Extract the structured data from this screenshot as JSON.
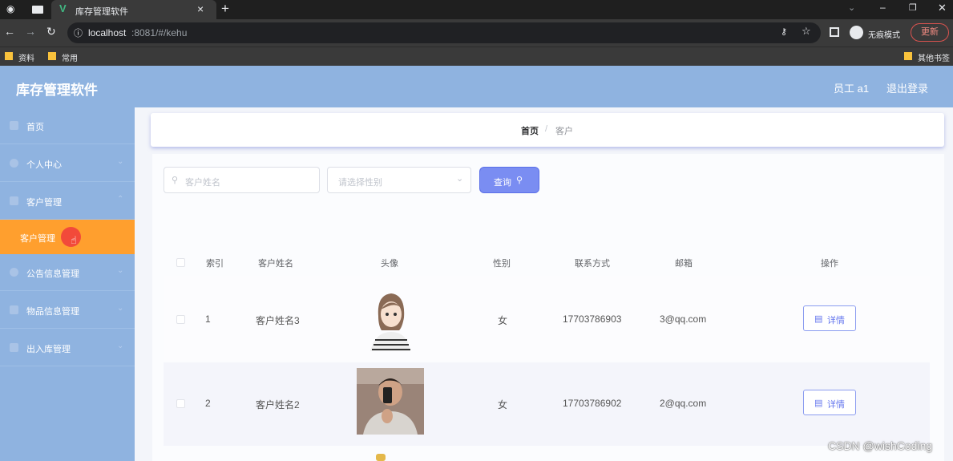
{
  "browser": {
    "tab_title": "库存管理软件",
    "tab_close": "×",
    "new_tab": "+",
    "url_host": "localhost",
    "url_rest": ":8081/#/kehu",
    "incognito": "无痕模式",
    "update": "更新",
    "bookmarks": [
      "资料",
      "常用"
    ],
    "other_bookmarks": "其他书签"
  },
  "app": {
    "title": "库存管理软件",
    "user": "员工 a1",
    "logout": "退出登录"
  },
  "sidebar": {
    "items": [
      "首页",
      "个人中心",
      "客户管理",
      "公告信息管理",
      "物品信息管理",
      "出入库管理"
    ],
    "sub_active": "客户管理"
  },
  "breadcrumb": {
    "home": "首页",
    "sep": "/",
    "current": "客户"
  },
  "search": {
    "name_placeholder": "客户姓名",
    "gender_placeholder": "请选择性别",
    "query_label": "查询"
  },
  "table": {
    "headers": [
      "索引",
      "客户姓名",
      "头像",
      "性别",
      "联系方式",
      "邮箱",
      "操作"
    ],
    "rows": [
      {
        "index": "1",
        "name": "客户姓名3",
        "gender": "女",
        "phone": "17703786903",
        "email": "3@qq.com",
        "action": "详情"
      },
      {
        "index": "2",
        "name": "客户姓名2",
        "gender": "女",
        "phone": "17703786902",
        "email": "2@qq.com",
        "action": "详情"
      }
    ]
  },
  "watermark": "CSDN @wishCoding",
  "colors": {
    "header": "#8fb3e0",
    "active_menu": "#ff9f2e",
    "button": "#7a8df2"
  }
}
